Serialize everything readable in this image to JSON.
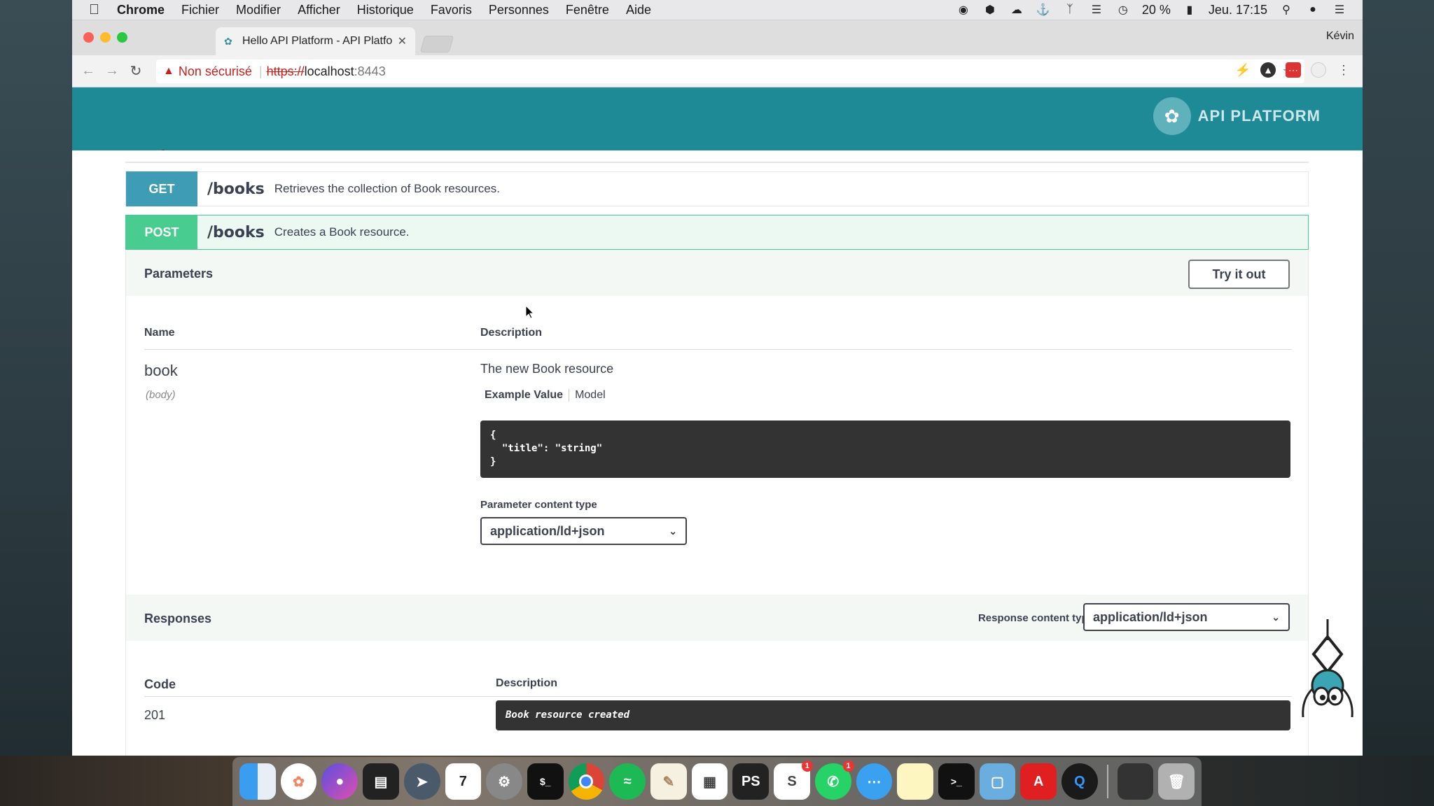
{
  "menubar": {
    "app": "Chrome",
    "items": [
      "Fichier",
      "Modifier",
      "Afficher",
      "Historique",
      "Favoris",
      "Personnes",
      "Fenêtre",
      "Aide"
    ],
    "battery": "20 %",
    "clock": "Jeu. 17:15"
  },
  "browser": {
    "tab_title": "Hello API Platform - API Platfo",
    "profile_name": "Kévin",
    "security_label": "Non sécurisé",
    "url_scheme": "https://",
    "url_host": "localhost",
    "url_port": ":8443"
  },
  "page": {
    "logo_text": "API PLATFORM",
    "section_title": "Book",
    "operations": [
      {
        "method": "GET",
        "path": "/books",
        "summary": "Retrieves the collection of Book resources.",
        "color": "#3e9cb5"
      },
      {
        "method": "POST",
        "path": "/books",
        "summary": "Creates a Book resource.",
        "color": "#49cc90"
      }
    ],
    "parameters": {
      "title": "Parameters",
      "try_button": "Try it out",
      "col_name": "Name",
      "col_description": "Description",
      "param_name": "book",
      "param_in": "(body)",
      "param_description": "The new Book resource",
      "example_tab": "Example Value",
      "model_tab": "Model",
      "example_code": "{\n  \"title\": \"string\"\n}",
      "content_type_label": "Parameter content type",
      "content_type_value": "application/ld+json"
    },
    "responses": {
      "title": "Responses",
      "content_type_label": "Response content type",
      "content_type_value": "application/ld+json",
      "col_code": "Code",
      "col_description": "Description",
      "code": "201",
      "description": "Book resource created"
    }
  },
  "dock": {
    "badges": {
      "slack": "1",
      "whatsapp": "1"
    }
  }
}
